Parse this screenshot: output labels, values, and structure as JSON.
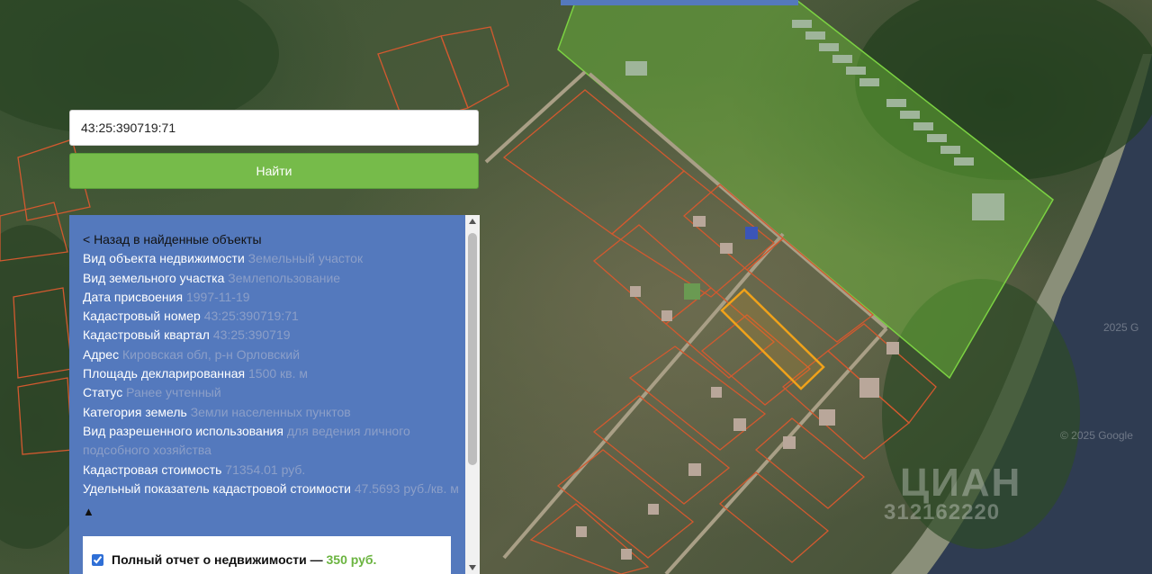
{
  "search": {
    "value": "43:25:390719:71",
    "button_label": "Найти"
  },
  "panel": {
    "back_label": "< Назад в найденные объекты",
    "fields": [
      {
        "label": "Вид объекта недвижимости",
        "value": "Земельный участок"
      },
      {
        "label": "Вид земельного участка",
        "value": "Землепользование"
      },
      {
        "label": "Дата присвоения",
        "value": "1997-11-19"
      },
      {
        "label": "Кадастровый номер",
        "value": "43:25:390719:71"
      },
      {
        "label": "Кадастровый квартал",
        "value": "43:25:390719"
      },
      {
        "label": "Адрес",
        "value": "Кировская обл, р-н Орловский"
      },
      {
        "label": "Площадь декларированная",
        "value": "1500 кв. м"
      },
      {
        "label": "Статус",
        "value": "Ранее учтенный"
      },
      {
        "label": "Категория земель",
        "value": "Земли населенных пунктов"
      },
      {
        "label": "Вид разрешенного использования",
        "value": "для ведения личного подсобного хозяйства"
      },
      {
        "label": "Кадастровая стоимость",
        "value": "71354.01 руб."
      },
      {
        "label": "Удельный показатель кадастровой стоимости",
        "value": "47.5693 руб./кв. м"
      }
    ],
    "collapse_symbol": "▲",
    "report": {
      "checked": true,
      "label": "Полный отчет о недвижимости —",
      "price": "350 руб."
    }
  },
  "map": {
    "watermark_logo": "ЦИАН",
    "watermark_number": "312162220",
    "copyright_1": "© 2025 Google",
    "copyright_2": "2025 G"
  },
  "colors": {
    "panel_bg": "#5479bd",
    "button_bg": "#76bb4a",
    "parcel_outline": "#d2592f",
    "selected_parcel": "#f0a21a",
    "zone_fill": "#6fbf3a"
  }
}
